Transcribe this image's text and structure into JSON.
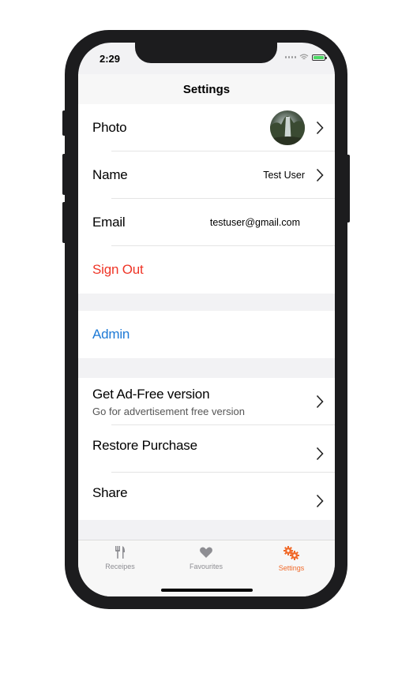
{
  "status_bar": {
    "time": "2:29"
  },
  "nav": {
    "title": "Settings"
  },
  "profile_section": {
    "photo_label": "Photo",
    "name_label": "Name",
    "name_value": "Test User",
    "email_label": "Email",
    "email_value": "testuser@gmail.com",
    "sign_out_label": "Sign Out"
  },
  "admin_section": {
    "admin_label": "Admin"
  },
  "purchase_section": {
    "ad_free_label": "Get Ad-Free version",
    "ad_free_subtitle": "Go for advertisement free version",
    "restore_label": "Restore Purchase",
    "share_label": "Share"
  },
  "tab_bar": {
    "tabs": [
      {
        "label": "Receipes",
        "icon": "fork-knife-icon"
      },
      {
        "label": "Favourites",
        "icon": "heart-icon"
      },
      {
        "label": "Settings",
        "icon": "gears-icon"
      }
    ],
    "active_index": 2
  },
  "colors": {
    "destructive": "#ef3527",
    "link": "#1e7ad6",
    "accent": "#f06a2a",
    "battery": "#4cd964"
  }
}
